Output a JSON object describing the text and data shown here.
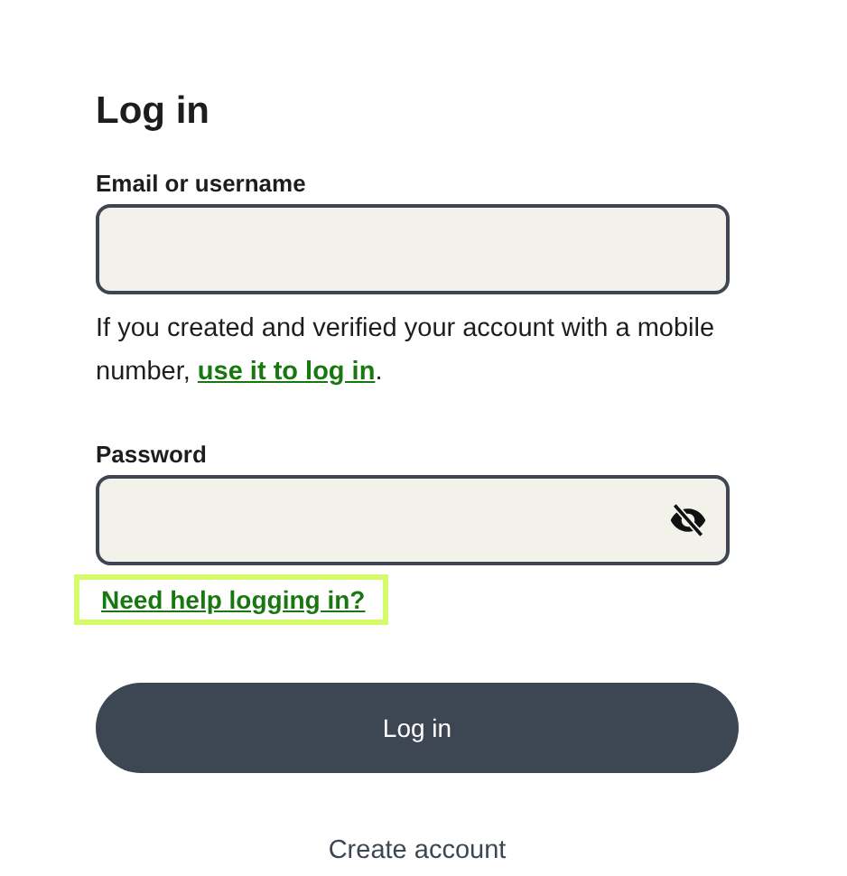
{
  "title": "Log in",
  "email": {
    "label": "Email or username"
  },
  "hint": {
    "text": "If you created and verified your account with a mobile number, ",
    "link": "use it to log in",
    "after": "."
  },
  "password": {
    "label": "Password",
    "revealed": false
  },
  "help_link": {
    "label": "Need help logging in?",
    "focused": true
  },
  "submit": {
    "label": "Log in"
  },
  "create_account": {
    "label": "Create account"
  }
}
